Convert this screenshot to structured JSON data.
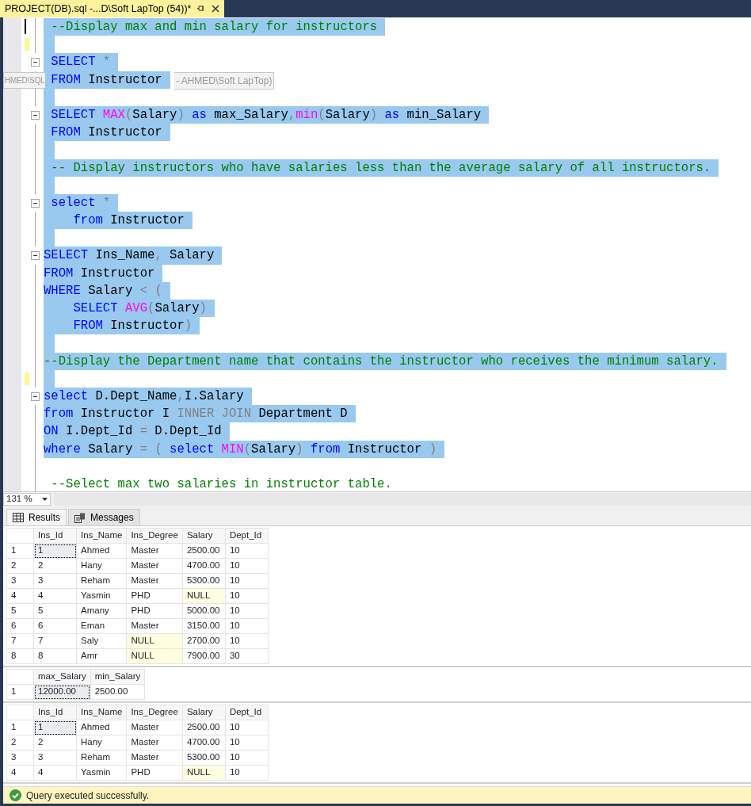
{
  "tab": {
    "title": "PROJECT(DB).sql -...D\\Soft LapTop (54))*",
    "selected": true
  },
  "tooltip": [
    "HMED\\SQL",
    "- AHMED\\Soft LapTop)"
  ],
  "editor": {
    "lines": [
      {
        "fold": false,
        "changed": false,
        "selected": true,
        "tokens": [
          {
            "kind": "comment",
            "text": " --Display max and min salary for instructors"
          }
        ]
      },
      {
        "fold": false,
        "changed": true,
        "selected": true
      },
      {
        "fold": true,
        "changed": false,
        "selected": true,
        "tokens": [
          {
            "kind": "keyword",
            "text": " SELECT"
          },
          {
            "kind": "operator",
            "text": " *"
          }
        ]
      },
      {
        "fold": false,
        "changed": false,
        "selected": true,
        "tokens": [
          {
            "kind": "keyword",
            "text": " FROM"
          },
          {
            "kind": "plain",
            "text": " Instructor"
          }
        ]
      },
      {
        "fold": false,
        "changed": false,
        "selected": true
      },
      {
        "fold": true,
        "changed": false,
        "selected": true,
        "tokens": [
          {
            "kind": "keyword",
            "text": " SELECT"
          },
          {
            "kind": "function",
            "text": " MAX"
          },
          {
            "kind": "operator",
            "text": "("
          },
          {
            "kind": "plain",
            "text": "Salary"
          },
          {
            "kind": "operator",
            "text": ")"
          },
          {
            "kind": "keyword",
            "text": " as"
          },
          {
            "kind": "plain",
            "text": " max_Salary"
          },
          {
            "kind": "operator",
            "text": ","
          },
          {
            "kind": "function",
            "text": "min"
          },
          {
            "kind": "operator",
            "text": "("
          },
          {
            "kind": "plain",
            "text": "Salary"
          },
          {
            "kind": "operator",
            "text": ")"
          },
          {
            "kind": "keyword",
            "text": " as"
          },
          {
            "kind": "plain",
            "text": " min_Salary"
          }
        ]
      },
      {
        "fold": false,
        "changed": false,
        "selected": true,
        "tokens": [
          {
            "kind": "keyword",
            "text": " FROM"
          },
          {
            "kind": "plain",
            "text": " Instructor"
          }
        ]
      },
      {
        "fold": false,
        "changed": false,
        "selected": true
      },
      {
        "fold": false,
        "changed": false,
        "selected": true,
        "tokens": [
          {
            "kind": "comment",
            "text": " -- Display instructors who have salaries less than the average salary of all instructors."
          }
        ]
      },
      {
        "fold": false,
        "changed": false,
        "selected": true
      },
      {
        "fold": true,
        "changed": false,
        "selected": true,
        "tokens": [
          {
            "kind": "keyword",
            "text": " select"
          },
          {
            "kind": "operator",
            "text": " *"
          }
        ]
      },
      {
        "fold": false,
        "changed": false,
        "selected": true,
        "tokens": [
          {
            "kind": "keyword",
            "text": "    from"
          },
          {
            "kind": "plain",
            "text": " Instructor"
          }
        ]
      },
      {
        "fold": false,
        "changed": false,
        "selected": true
      },
      {
        "fold": true,
        "changed": false,
        "selected": true,
        "tokens": [
          {
            "kind": "keyword",
            "text": "SELECT"
          },
          {
            "kind": "plain",
            "text": " Ins_Name"
          },
          {
            "kind": "operator",
            "text": ","
          },
          {
            "kind": "plain",
            "text": " Salary"
          }
        ]
      },
      {
        "fold": false,
        "changed": false,
        "selected": true,
        "tokens": [
          {
            "kind": "keyword",
            "text": "FROM"
          },
          {
            "kind": "plain",
            "text": " Instructor"
          }
        ]
      },
      {
        "fold": false,
        "changed": false,
        "selected": true,
        "tokens": [
          {
            "kind": "keyword",
            "text": "WHERE"
          },
          {
            "kind": "plain",
            "text": " Salary"
          },
          {
            "kind": "operator",
            "text": " < ("
          }
        ]
      },
      {
        "fold": false,
        "changed": false,
        "selected": true,
        "tokens": [
          {
            "kind": "keyword",
            "text": "    SELECT"
          },
          {
            "kind": "function",
            "text": " AVG"
          },
          {
            "kind": "operator",
            "text": "("
          },
          {
            "kind": "plain",
            "text": "Salary"
          },
          {
            "kind": "operator",
            "text": ")"
          }
        ]
      },
      {
        "fold": false,
        "changed": false,
        "selected": true,
        "tokens": [
          {
            "kind": "keyword",
            "text": "    FROM"
          },
          {
            "kind": "plain",
            "text": " Instructor"
          },
          {
            "kind": "operator",
            "text": ")"
          }
        ]
      },
      {
        "fold": false,
        "changed": false,
        "selected": true
      },
      {
        "fold": false,
        "changed": false,
        "selected": true,
        "tokens": [
          {
            "kind": "comment",
            "text": "--Display the Department name that contains the instructor who receives the minimum salary."
          }
        ]
      },
      {
        "fold": false,
        "changed": true,
        "selected": true
      },
      {
        "fold": true,
        "changed": false,
        "selected": true,
        "tokens": [
          {
            "kind": "keyword",
            "text": "select"
          },
          {
            "kind": "plain",
            "text": " D.Dept_Name"
          },
          {
            "kind": "operator",
            "text": ","
          },
          {
            "kind": "plain",
            "text": "I.Salary"
          }
        ]
      },
      {
        "fold": false,
        "changed": false,
        "selected": true,
        "tokens": [
          {
            "kind": "keyword",
            "text": "from"
          },
          {
            "kind": "plain",
            "text": " Instructor I"
          },
          {
            "kind": "operator",
            "text": " INNER JOIN"
          },
          {
            "kind": "plain",
            "text": " Department D"
          }
        ]
      },
      {
        "fold": false,
        "changed": false,
        "selected": true,
        "tokens": [
          {
            "kind": "keyword",
            "text": "ON"
          },
          {
            "kind": "plain",
            "text": " I.Dept_Id"
          },
          {
            "kind": "operator",
            "text": " ="
          },
          {
            "kind": "plain",
            "text": " D.Dept_Id"
          }
        ]
      },
      {
        "fold": false,
        "changed": false,
        "selected": true,
        "tokens": [
          {
            "kind": "keyword",
            "text": "where"
          },
          {
            "kind": "plain",
            "text": " Salary"
          },
          {
            "kind": "operator",
            "text": " = ("
          },
          {
            "kind": "keyword",
            "text": " select"
          },
          {
            "kind": "function",
            "text": " MIN"
          },
          {
            "kind": "operator",
            "text": "("
          },
          {
            "kind": "plain",
            "text": "Salary"
          },
          {
            "kind": "operator",
            "text": ")"
          },
          {
            "kind": "keyword",
            "text": " from"
          },
          {
            "kind": "plain",
            "text": " Instructor"
          },
          {
            "kind": "operator",
            "text": " )"
          }
        ]
      },
      {
        "fold": false,
        "changed": false,
        "selected": false
      },
      {
        "fold": false,
        "changed": false,
        "selected": false,
        "tokens": [
          {
            "kind": "comment",
            "text": " --Select max two salaries in instructor table."
          }
        ]
      }
    ]
  },
  "zoom": "131 %",
  "result_tabs": [
    {
      "label": "Results",
      "kind": "grid",
      "selected": true
    },
    {
      "label": "Messages",
      "kind": "messages",
      "selected": false
    }
  ],
  "grids": [
    {
      "columns": [
        "Ins_Id",
        "Ins_Name",
        "Ins_Degree",
        "Salary",
        "Dept_Id"
      ],
      "rows": [
        {
          "number": "1",
          "cells": [
            {
              "value": "1",
              "focused": true
            },
            "Ahmed",
            "Master",
            "2500.00",
            "10"
          ]
        },
        {
          "number": "2",
          "cells": [
            "2",
            "Hany",
            "Master",
            "4700.00",
            "10"
          ]
        },
        {
          "number": "3",
          "cells": [
            "3",
            "Reham",
            "Master",
            "5300.00",
            "10"
          ]
        },
        {
          "number": "4",
          "cells": [
            "4",
            "Yasmin",
            "PHD",
            {
              "value": "NULL",
              "null": true
            },
            "10"
          ]
        },
        {
          "number": "5",
          "cells": [
            "5",
            "Amany",
            "PHD",
            "5000.00",
            "10"
          ]
        },
        {
          "number": "6",
          "cells": [
            "6",
            "Eman",
            "Master",
            "3150.00",
            "10"
          ]
        },
        {
          "number": "7",
          "cells": [
            "7",
            "Saly",
            {
              "value": "NULL",
              "null": true
            },
            "2700.00",
            "10"
          ]
        },
        {
          "number": "8",
          "cells": [
            "8",
            "Amr",
            {
              "value": "NULL",
              "null": true
            },
            "7900.00",
            "30"
          ]
        }
      ]
    },
    {
      "columns": [
        "max_Salary",
        "min_Salary"
      ],
      "rows": [
        {
          "number": "1",
          "cells": [
            {
              "value": "12000.00",
              "focused": true
            },
            "2500.00"
          ]
        }
      ]
    },
    {
      "columns": [
        "Ins_Id",
        "Ins_Name",
        "Ins_Degree",
        "Salary",
        "Dept_Id"
      ],
      "rows": [
        {
          "number": "1",
          "cells": [
            {
              "value": "1",
              "focused": true
            },
            "Ahmed",
            "Master",
            "2500.00",
            "10"
          ]
        },
        {
          "number": "2",
          "cells": [
            "2",
            "Hany",
            "Master",
            "4700.00",
            "10"
          ]
        },
        {
          "number": "3",
          "cells": [
            "3",
            "Reham",
            "Master",
            "5300.00",
            "10"
          ]
        },
        {
          "number": "4",
          "cells": [
            "4",
            "Yasmin",
            "PHD",
            {
              "value": "NULL",
              "null": true
            },
            "10"
          ]
        }
      ]
    }
  ],
  "status": {
    "text": "Query executed successfully.",
    "kind": "success"
  }
}
